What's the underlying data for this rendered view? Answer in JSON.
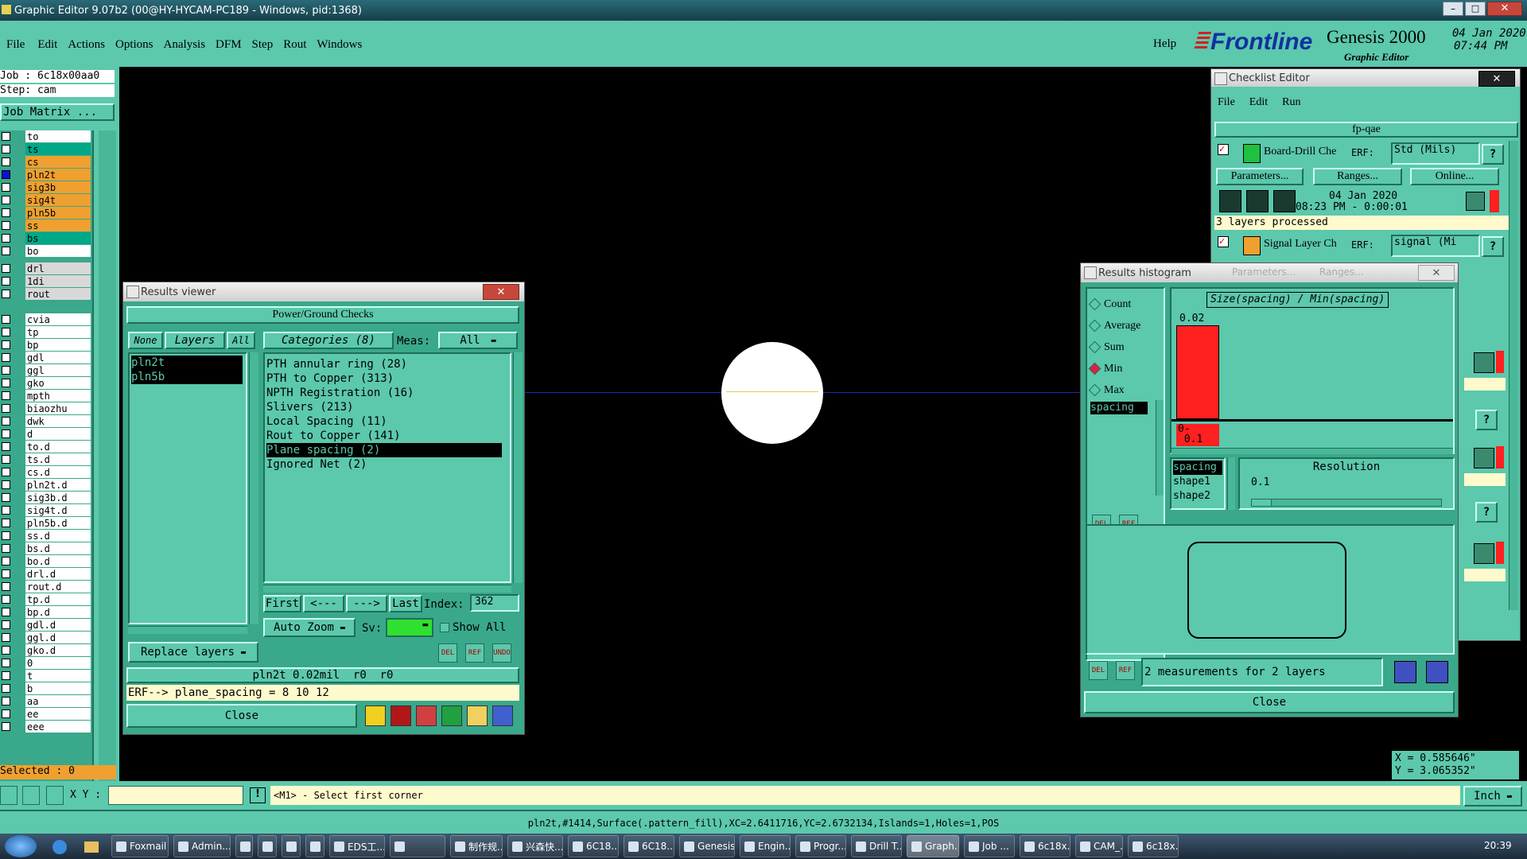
{
  "window_title": "Graphic Editor 9.07b2 (00@HY-HYCAM-PC189 - Windows, pid:1368)",
  "menu": [
    "File",
    "Edit",
    "Actions",
    "Options",
    "Analysis",
    "DFM",
    "Step",
    "Rout",
    "Windows"
  ],
  "help": "Help",
  "brand": {
    "logo": "Frontline",
    "product": "Genesis 2000",
    "subtitle": "Graphic Editor",
    "date": "04 Jan 2020",
    "time": "07:44 PM"
  },
  "job": {
    "job_label": "Job : 6c18x00aa0",
    "step_label": "Step: cam",
    "matrix_button": "Job Matrix ..."
  },
  "layers_top": [
    {
      "name": "to",
      "color": "#ffffff"
    },
    {
      "name": "ts",
      "color": "#00a888"
    },
    {
      "name": "cs",
      "color": "#f0a030"
    },
    {
      "name": "pln2t",
      "color": "#f0a030"
    },
    {
      "name": "sig3b",
      "color": "#f0a030"
    },
    {
      "name": "sig4t",
      "color": "#f0a030"
    },
    {
      "name": "pln5b",
      "color": "#f0a030"
    },
    {
      "name": "ss",
      "color": "#f0a030"
    },
    {
      "name": "bs",
      "color": "#00a888"
    },
    {
      "name": "bo",
      "color": "#ffffff"
    }
  ],
  "layers_drill": [
    "drl",
    "1di",
    "rout"
  ],
  "layers_misc": [
    "cvia",
    "tp",
    "bp",
    "gdl",
    "ggl",
    "gko",
    "mpth",
    "biaozhu",
    "dwk",
    "d",
    "to.d",
    "ts.d",
    "cs.d",
    "pln2t.d",
    "sig3b.d",
    "sig4t.d",
    "pln5b.d",
    "ss.d",
    "bs.d",
    "bo.d",
    "drl.d",
    "rout.d",
    "tp.d",
    "bp.d",
    "gdl.d",
    "ggl.d",
    "gko.d",
    "0",
    "t",
    "b",
    "aa",
    "ee",
    "eee"
  ],
  "selected": "Selected : 0",
  "results_viewer": {
    "title": "Results viewer",
    "header": "Power/Ground Checks",
    "none": "None",
    "layers": "Layers",
    "all": "All",
    "categories_label": "Categories (8)",
    "meas_label": "Meas:",
    "meas_value": "All",
    "layer_items": [
      "pln2t",
      "pln5b"
    ],
    "categories": [
      "PTH annular ring (28)",
      "PTH to Copper (313)",
      "NPTH Registration (16)",
      "Slivers (213)",
      "Local Spacing (11)",
      "Rout to Copper (141)",
      "Plane spacing (2)",
      "Ignored Net (2)"
    ],
    "nav_first": "First",
    "nav_prev": "<---",
    "nav_next": "--->",
    "nav_last": "Last",
    "index_label": "Index:",
    "index_value": "362",
    "auto_zoom": "Auto Zoom",
    "sv_label": "Sv:",
    "show_all": "Show All",
    "replace_layers": "Replace layers",
    "status": "pln2t 0.02mil  r0  r0",
    "erf": "ERF--> plane_spacing = 8 10 12",
    "close": "Close",
    "icons": {
      "del": "DEL",
      "ref": "REF",
      "undo": "UNDO"
    }
  },
  "checklist": {
    "title": "Checklist Editor",
    "menu": [
      "File",
      "Edit",
      "Run"
    ],
    "name": "fp-qae",
    "item1_label": "Board-Drill Che",
    "erf_label": "ERF:",
    "item1_erf": "Std (Mils)",
    "params": "Parameters...",
    "ranges": "Ranges...",
    "online": "Online...",
    "run_date": "04 Jan 2020",
    "run_time": "08:23 PM - 0:00:01",
    "processed": "3 layers processed",
    "item2_label": "Signal Layer Ch",
    "item2_erf": "signal (Mi",
    "help_mark": "?"
  },
  "histogram": {
    "title": "Results histogram",
    "ghost_params": "Parameters...",
    "ghost_ranges": "Ranges...",
    "modes": [
      "Count",
      "Average",
      "Sum",
      "Min",
      "Max"
    ],
    "mode_selected": "Min",
    "list_item": "spacing",
    "chart_title": "Size(spacing) / Min(spacing)",
    "bar_value_label": "0.02",
    "bar_range_label": "0-\n 0.1",
    "shape_items": [
      "spacing",
      "shape1",
      "shape2"
    ],
    "resolution_label": "Resolution",
    "resolution_value": "0.1",
    "measurements": "2 measurements for 2 layers",
    "close": "Close"
  },
  "coords": {
    "x": "X = 0.585646\"",
    "y": "Y = 3.065352\""
  },
  "bottom": {
    "xy_label": "X Y :",
    "prompt": "<M1> - Select first corner",
    "units": "Inch",
    "status_line": "pln2t,#1414,Surface(.pattern_fill),XC=2.6411716,YC=2.6732134,Islands=1,Holes=1,POS"
  },
  "taskbar": {
    "items": [
      "Foxmail",
      "Admin...",
      "",
      "",
      "",
      "",
      "EDS工...",
      "",
      "制作规...",
      "兴森快...",
      "6C18...",
      "6C18...",
      "Genesis",
      "Engin...",
      "Progr...",
      "Drill T...",
      "Graph...",
      "Job ...",
      "6c18x...",
      "CAM_...",
      "6c18x..."
    ],
    "clock": "20:39"
  },
  "colors": {
    "teal": "#5cc8ac",
    "teal_dark": "#49b898",
    "highlight": "#000000",
    "canvas": "#000000",
    "bar": "#ff2020"
  }
}
